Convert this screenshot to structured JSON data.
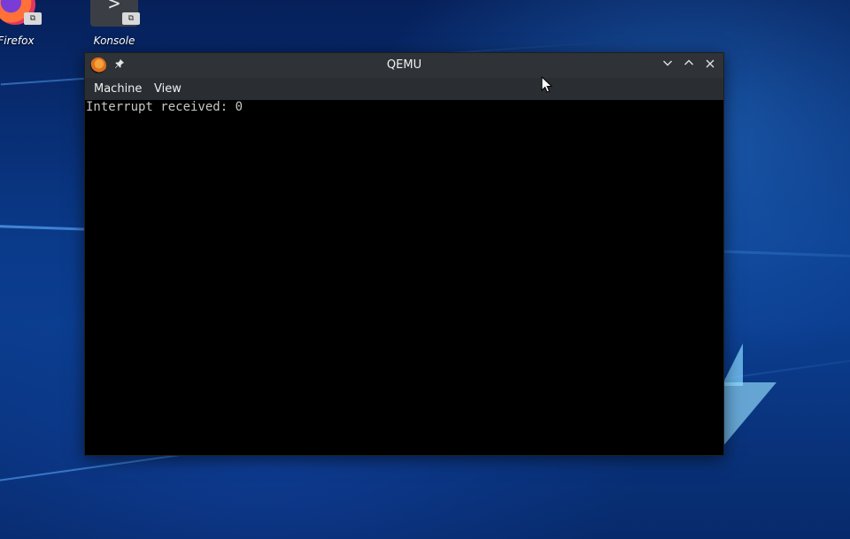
{
  "desktop": {
    "icons": [
      {
        "label": "Firefox"
      },
      {
        "label": "Konsole"
      }
    ],
    "link_badge": "⧉"
  },
  "window": {
    "title": "QEMU",
    "buttons": {
      "minimize": "⌄",
      "maximize": "⌃",
      "close": "✕"
    },
    "pin_glyph": "📌"
  },
  "menubar": {
    "items": [
      {
        "label": "Machine"
      },
      {
        "label": "View"
      }
    ]
  },
  "screen": {
    "lines": [
      "Interrupt received: 0"
    ]
  },
  "colors": {
    "titlebar": "#2f3337",
    "menubar": "#2a2e32",
    "screen": "#000000",
    "console_text": "#c6c6c6"
  }
}
